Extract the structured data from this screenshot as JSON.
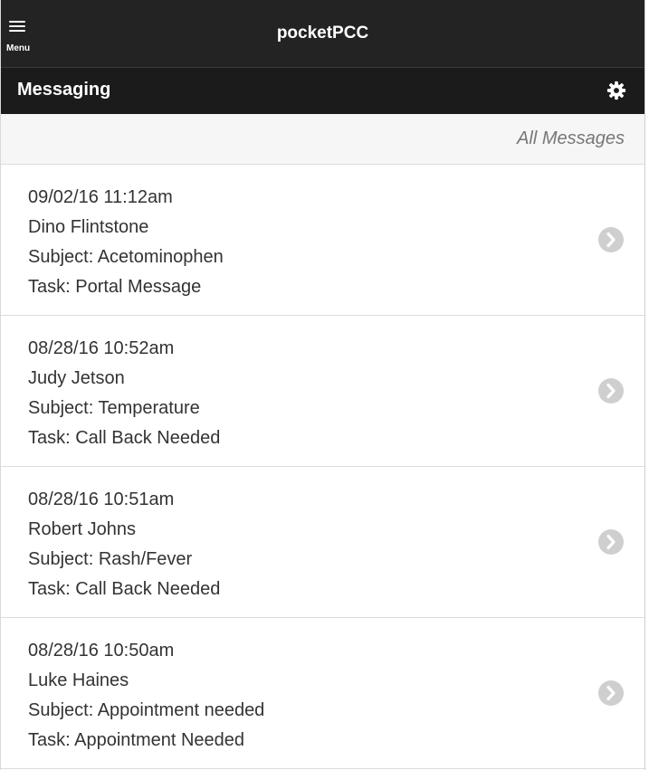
{
  "header": {
    "menu_label": "Menu",
    "app_title": "pocketPCC"
  },
  "subheader": {
    "title": "Messaging",
    "settings_icon": "gear-icon"
  },
  "filter": {
    "label": "All Messages"
  },
  "messages": [
    {
      "datetime": "09/02/16 11:12am",
      "name": "Dino Flintstone",
      "subject": "Subject: Acetominophen",
      "task": "Task: Portal Message"
    },
    {
      "datetime": "08/28/16 10:52am",
      "name": "Judy Jetson",
      "subject": "Subject: Temperature",
      "task": "Task: Call Back Needed"
    },
    {
      "datetime": "08/28/16 10:51am",
      "name": "Robert Johns",
      "subject": "Subject: Rash/Fever",
      "task": "Task: Call Back Needed"
    },
    {
      "datetime": "08/28/16 10:50am",
      "name": "Luke Haines",
      "subject": "Subject: Appointment needed",
      "task": "Task: Appointment Needed"
    }
  ],
  "colors": {
    "header_bg": "#232323",
    "subheader_bg": "#1b1b1b",
    "chevron": "#cfcfcf",
    "filter_text": "#777777"
  }
}
